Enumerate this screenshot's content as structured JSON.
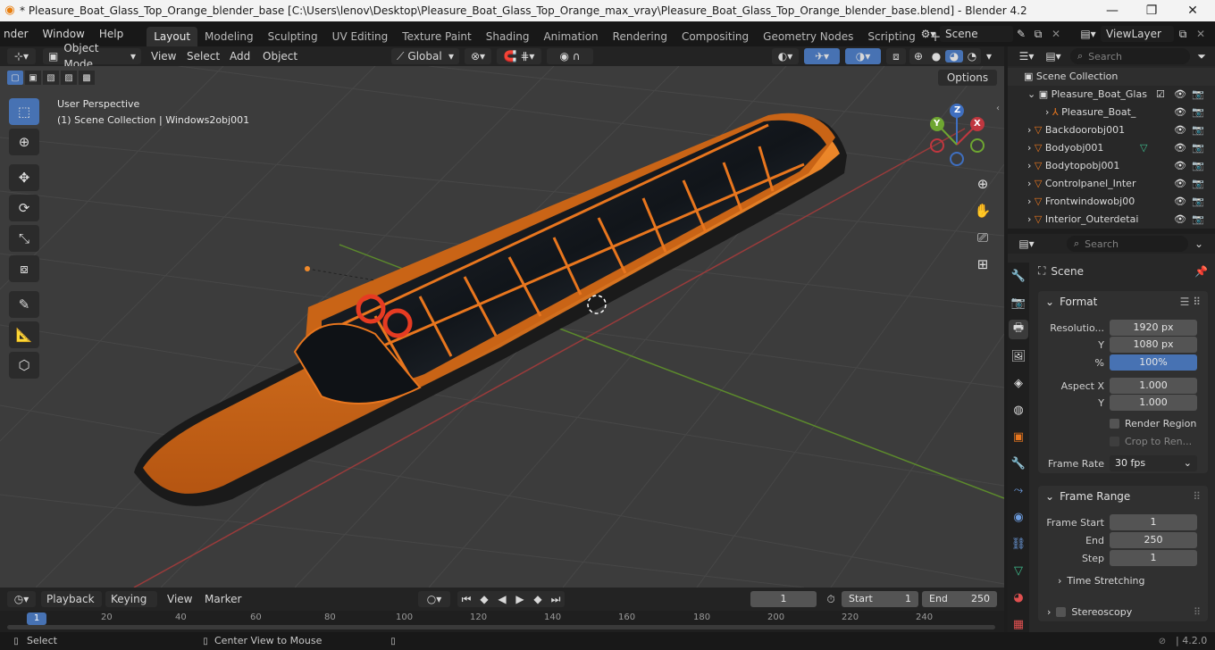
{
  "window": {
    "title": "* Pleasure_Boat_Glass_Top_Orange_blender_base [C:\\Users\\lenov\\Desktop\\Pleasure_Boat_Glass_Top_Orange_max_vray\\Pleasure_Boat_Glass_Top_Orange_blender_base.blend] - Blender 4.2",
    "minimize": "—",
    "maximize": "❐",
    "close": "✕"
  },
  "menu": [
    "nder",
    "Window",
    "Help"
  ],
  "workspaces": [
    "Layout",
    "Modeling",
    "Sculpting",
    "UV Editing",
    "Texture Paint",
    "Shading",
    "Animation",
    "Rendering",
    "Compositing",
    "Geometry Nodes",
    "Scripting"
  ],
  "active_workspace": "Layout",
  "scene_name": "Scene",
  "view_layer": "ViewLayer",
  "viewport_header": {
    "mode": "Object Mode",
    "menus": [
      "View",
      "Select",
      "Add",
      "Object"
    ],
    "transform_orientation": "Global",
    "options_label": "Options"
  },
  "viewport": {
    "perspective": "User Perspective",
    "collection_info": "(1) Scene Collection | Windows2obj001",
    "gizmo": {
      "x": "X",
      "y": "Y",
      "z": "Z"
    }
  },
  "outliner": {
    "search_placeholder": "Search",
    "root": "Scene Collection",
    "rows": [
      {
        "label": "Pleasure_Boat_Glas"
      },
      {
        "label": "Pleasure_Boat_"
      },
      {
        "label": "Backdoorobj001"
      },
      {
        "label": "Bodyobj001"
      },
      {
        "label": "Bodytopobj001"
      },
      {
        "label": "Controlpanel_Inter"
      },
      {
        "label": "Frontwindowobj00"
      },
      {
        "label": "Interior_Outerdetai"
      }
    ]
  },
  "properties": {
    "search_placeholder": "Search",
    "context": "Scene",
    "format_panel": "Format",
    "resolution_x_label": "Resolutio...",
    "resolution_x": "1920 px",
    "resolution_y_label": "Y",
    "resolution_y": "1080 px",
    "percent_label": "%",
    "percent": "100%",
    "aspect_x_label": "Aspect X",
    "aspect_x": "1.000",
    "aspect_y_label": "Y",
    "aspect_y": "1.000",
    "render_region": "Render Region",
    "crop": "Crop to Ren...",
    "frame_rate_label": "Frame Rate",
    "frame_rate": "30 fps",
    "frame_range_panel": "Frame Range",
    "frame_start_label": "Frame Start",
    "frame_start": "1",
    "end_label": "End",
    "end": "250",
    "step_label": "Step",
    "step": "1",
    "time_stretching": "Time Stretching",
    "stereoscopy": "Stereoscopy"
  },
  "timeline": {
    "menus": [
      "Playback",
      "Keying",
      "View",
      "Marker"
    ],
    "current_frame": "1",
    "start_label": "Start",
    "start": "1",
    "end_label": "End",
    "end": "250",
    "ticks": [
      "1",
      "20",
      "40",
      "60",
      "80",
      "100",
      "120",
      "140",
      "160",
      "180",
      "200",
      "220",
      "240"
    ]
  },
  "statusbar": {
    "select": "Select",
    "center": "Center View to Mouse",
    "version": "4.2.0"
  },
  "colors": {
    "accent": "#4772b3",
    "boat_orange": "#e8761e",
    "grid_bg": "#3c3c3c"
  }
}
